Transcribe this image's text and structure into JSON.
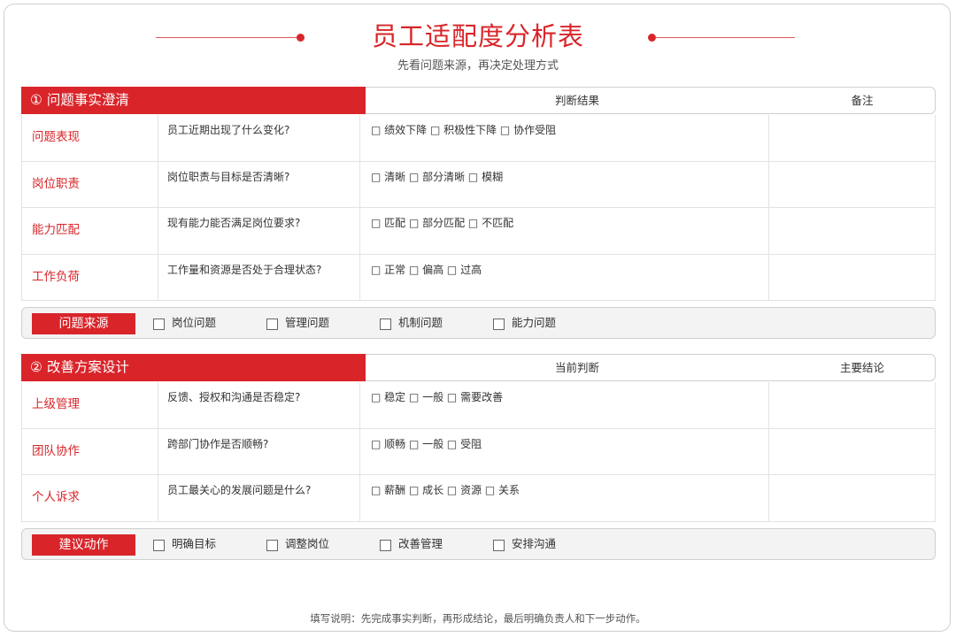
{
  "header": {
    "title": "员工适配度分析表",
    "subtitle": "先看问题来源，再决定处理方式"
  },
  "section1": {
    "title": "① 问题事实澄清",
    "col_mid": "判断结果",
    "col_right": "备注",
    "rows": [
      {
        "label": "问题表现",
        "question": "员工近期出现了什么变化?",
        "options": "□ 绩效下降 □ 积极性下降 □ 协作受阻"
      },
      {
        "label": "岗位职责",
        "question": "岗位职责与目标是否清晰?",
        "options": "□ 清晰 □ 部分清晰 □ 模糊"
      },
      {
        "label": "能力匹配",
        "question": "现有能力能否满足岗位要求?",
        "options": "□ 匹配 □ 部分匹配 □ 不匹配"
      },
      {
        "label": "工作负荷",
        "question": "工作量和资源是否处于合理状态?",
        "options": "□ 正常 □ 偏高 □ 过高"
      }
    ],
    "bar": {
      "label": "问题来源",
      "items": [
        "岗位问题",
        "管理问题",
        "机制问题",
        "能力问题"
      ]
    }
  },
  "section2": {
    "title": "② 改善方案设计",
    "col_mid": "当前判断",
    "col_right": "主要结论",
    "rows": [
      {
        "label": "上级管理",
        "question": "反馈、授权和沟通是否稳定?",
        "options": "□ 稳定 □ 一般 □ 需要改善"
      },
      {
        "label": "团队协作",
        "question": "跨部门协作是否顺畅?",
        "options": "□ 顺畅 □ 一般 □ 受阻"
      },
      {
        "label": "个人诉求",
        "question": "员工最关心的发展问题是什么?",
        "options": "□ 薪酬 □ 成长 □ 资源 □ 关系"
      }
    ],
    "bar": {
      "label": "建议动作",
      "items": [
        "明确目标",
        "调整岗位",
        "改善管理",
        "安排沟通"
      ]
    }
  },
  "footer": {
    "note": "填写说明：先完成事实判断，再形成结论，最后明确负责人和下一步动作。"
  },
  "colors": {
    "accent": "#d9252a",
    "border": "#cfcfcf",
    "bar_bg": "#f3f3f3"
  }
}
